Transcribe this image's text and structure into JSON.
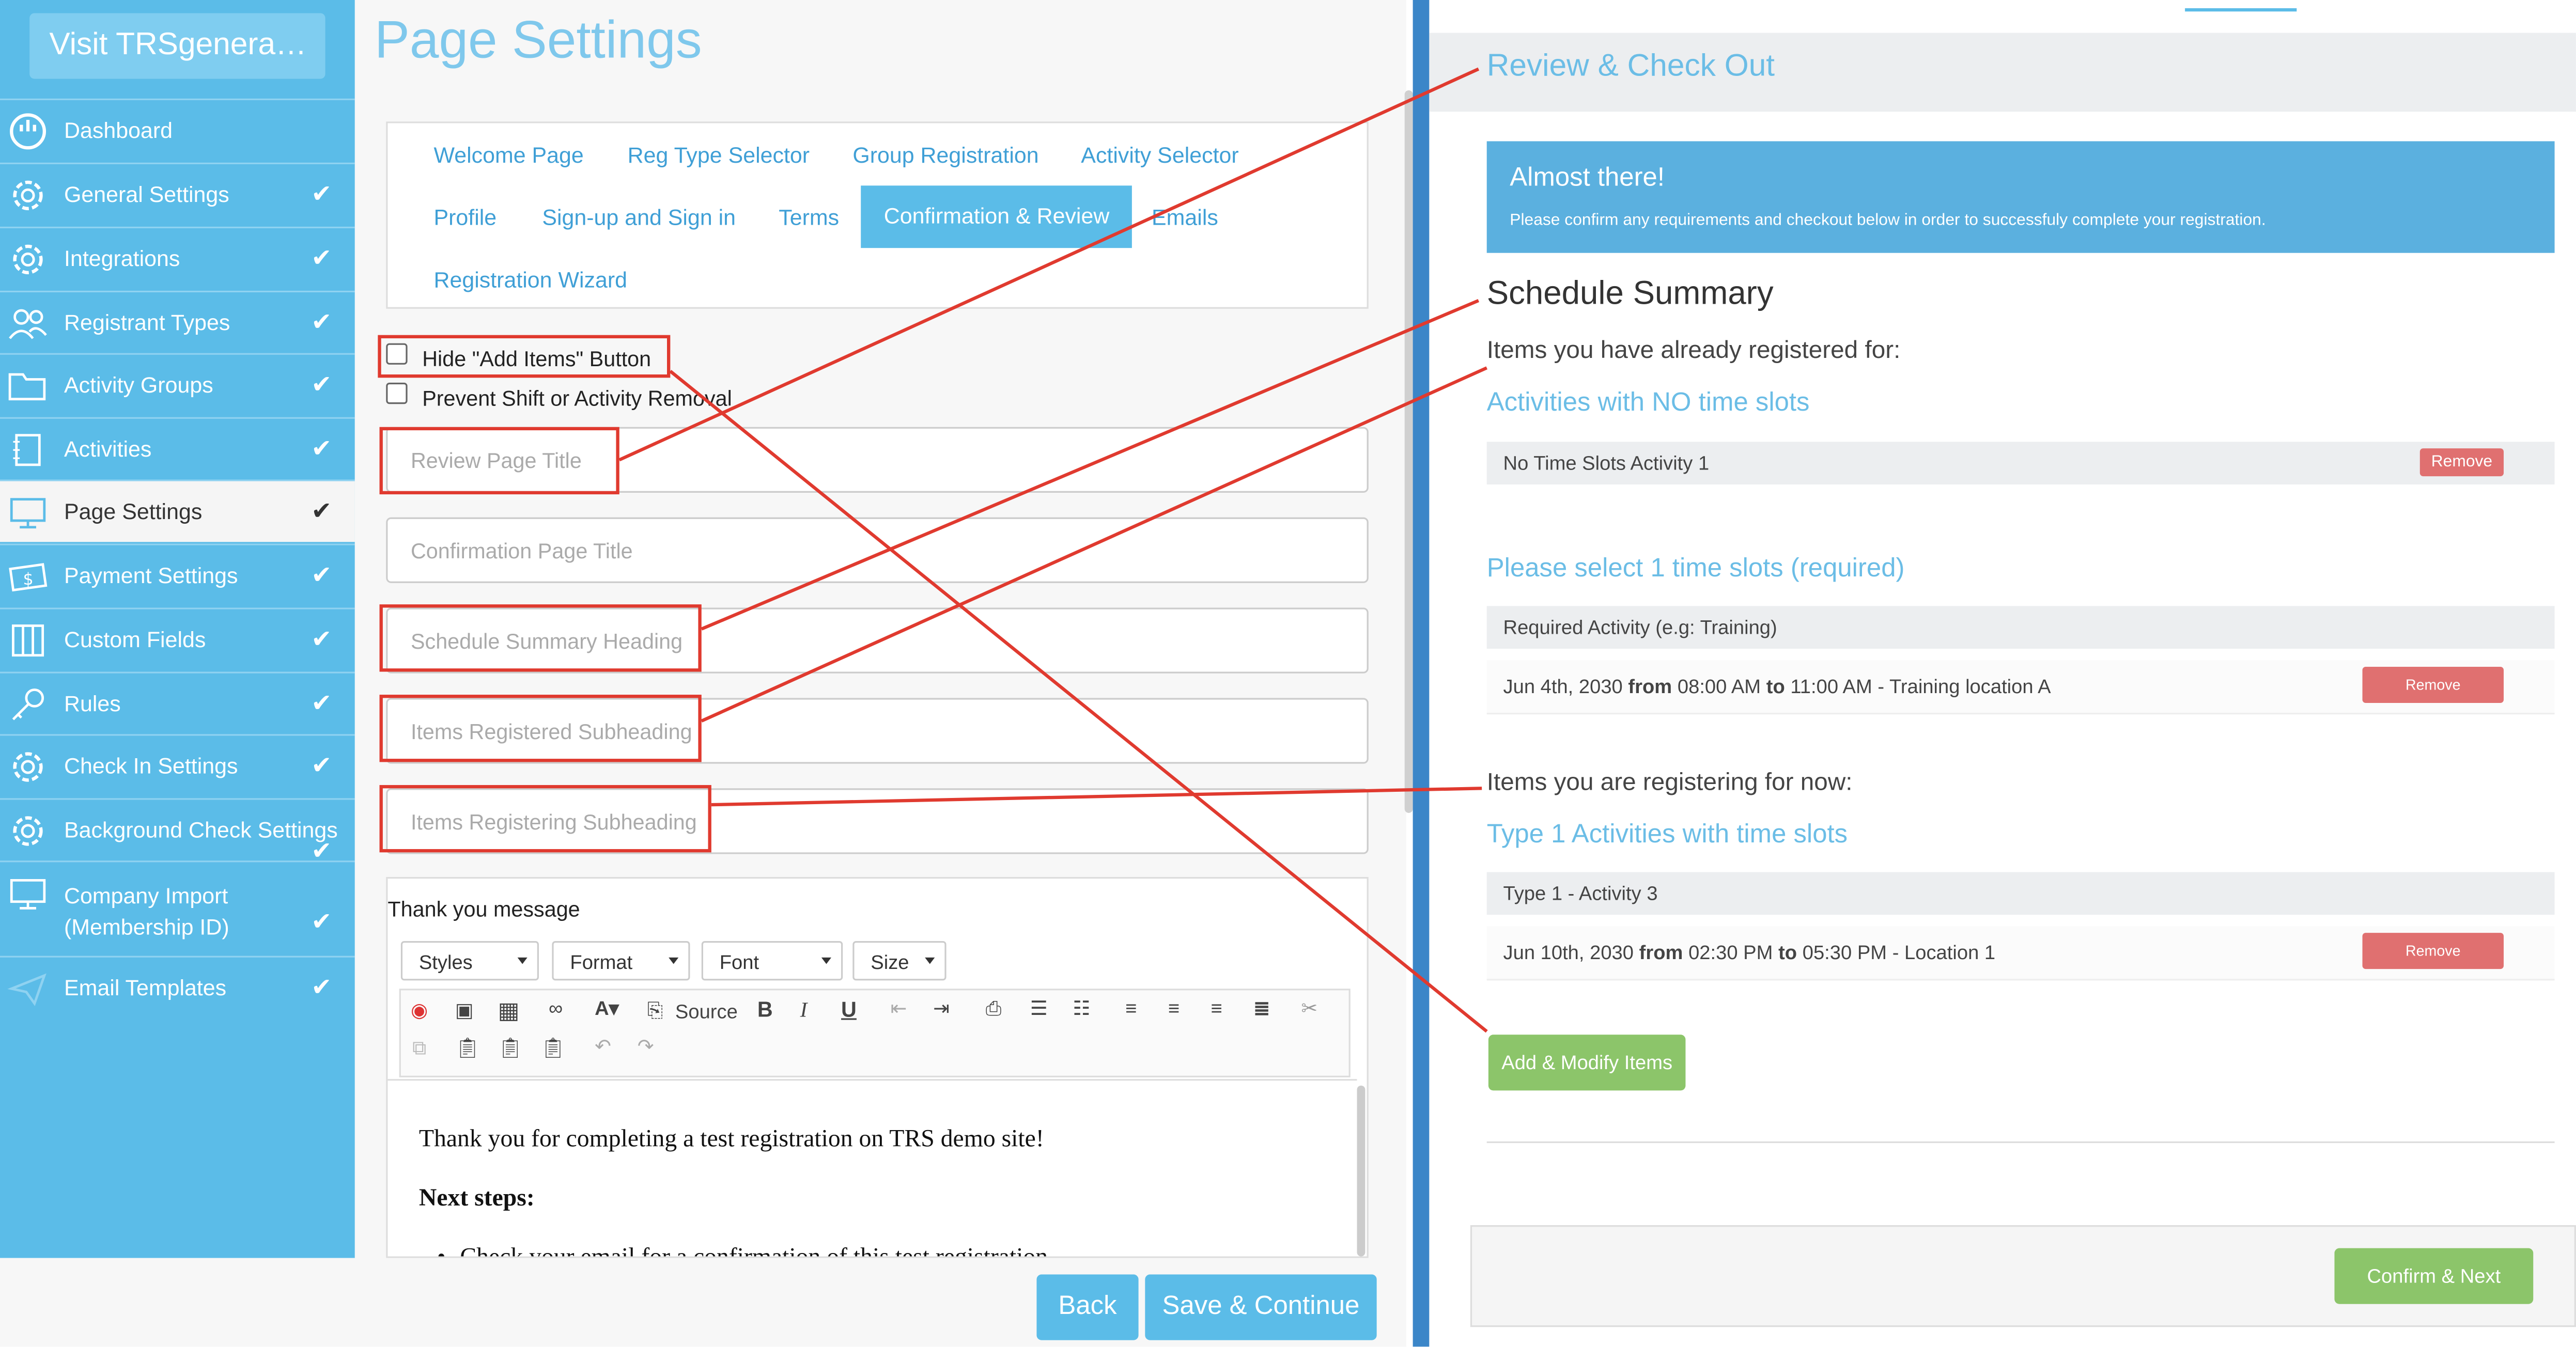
{
  "sidebar": {
    "visit_button": "Visit TRSgenera…",
    "items": [
      {
        "label": "Dashboard",
        "check": ""
      },
      {
        "label": "General Settings",
        "check": "✔"
      },
      {
        "label": "Integrations",
        "check": "✔"
      },
      {
        "label": "Registrant Types",
        "check": "✔"
      },
      {
        "label": "Activity Groups",
        "check": "✔"
      },
      {
        "label": "Activities",
        "check": "✔"
      },
      {
        "label": "Page Settings",
        "check": "✔"
      },
      {
        "label": "Payment Settings",
        "check": "✔"
      },
      {
        "label": "Custom Fields",
        "check": "✔"
      },
      {
        "label": "Rules",
        "check": "✔"
      },
      {
        "label": "Check In Settings",
        "check": "✔"
      },
      {
        "label": "Background Check Settings",
        "check": "✔"
      },
      {
        "label": "Company Import (Membership ID)",
        "check": "✔"
      },
      {
        "label": "Email Templates",
        "check": "✔"
      }
    ]
  },
  "page": {
    "title": "Page Settings",
    "tabs": [
      "Welcome Page",
      "Reg Type Selector",
      "Group Registration",
      "Activity Selector",
      "Profile",
      "Sign-up and Sign in",
      "Terms",
      "Confirmation & Review",
      "Emails",
      "Registration Wizard"
    ],
    "checkbox_hide": "Hide \"Add Items\" Button",
    "checkbox_prevent": "Prevent Shift or Activity Removal",
    "inputs": {
      "review_title": "Review Page Title",
      "confirmation_title": "Confirmation Page Title",
      "schedule_heading": "Schedule Summary Heading",
      "registered_sub": "Items Registered Subheading",
      "registering_sub": "Items Registering Subheading"
    },
    "editor": {
      "label": "Thank you message",
      "styles": "Styles",
      "format": "Format",
      "font": "Font",
      "size": "Size",
      "source": "Source",
      "content_line1": "Thank you for completing a test registration on TRS demo site!",
      "content_heading": "Next steps:",
      "content_bullet": "Check your email for a confirmation of this test registration"
    },
    "back": "Back",
    "save": "Save & Continue"
  },
  "preview": {
    "title": "Review & Check Out",
    "banner_title": "Almost there!",
    "banner_text": "Please confirm any requirements and checkout below in order to successfuly complete your registration.",
    "schedule_summary": "Schedule Summary",
    "already_registered": "Items you have already registered for:",
    "no_slots_heading": "Activities with NO time slots",
    "no_slots_activity": "No Time Slots Activity 1",
    "remove": "Remove",
    "select_slots": "Please select 1 time slots (required)",
    "required_activity": "Required Activity (e.g: Training)",
    "slot1_date": "Jun 4th, 2030",
    "slot1_from": "from",
    "slot1_start": "08:00 AM",
    "slot1_to": "to",
    "slot1_end": "11:00 AM",
    "slot1_loc": "- Training location A",
    "registering_now": "Items you are registering for now:",
    "type1_heading": "Type 1 Activities with time slots",
    "type1_activity": "Type 1 - Activity 3",
    "slot2_date": "Jun 10th, 2030",
    "slot2_start": "02:30 PM",
    "slot2_end": "05:30 PM",
    "slot2_loc": "- Location 1",
    "add_modify": "Add & Modify Items",
    "confirm_next": "Confirm & Next"
  },
  "colors": {
    "sidebar": "#5bbce8",
    "accent_blue": "#6bbde6",
    "annotation_red": "#e03a2f",
    "green_button": "#8cc56a",
    "remove_red": "#e07070"
  }
}
